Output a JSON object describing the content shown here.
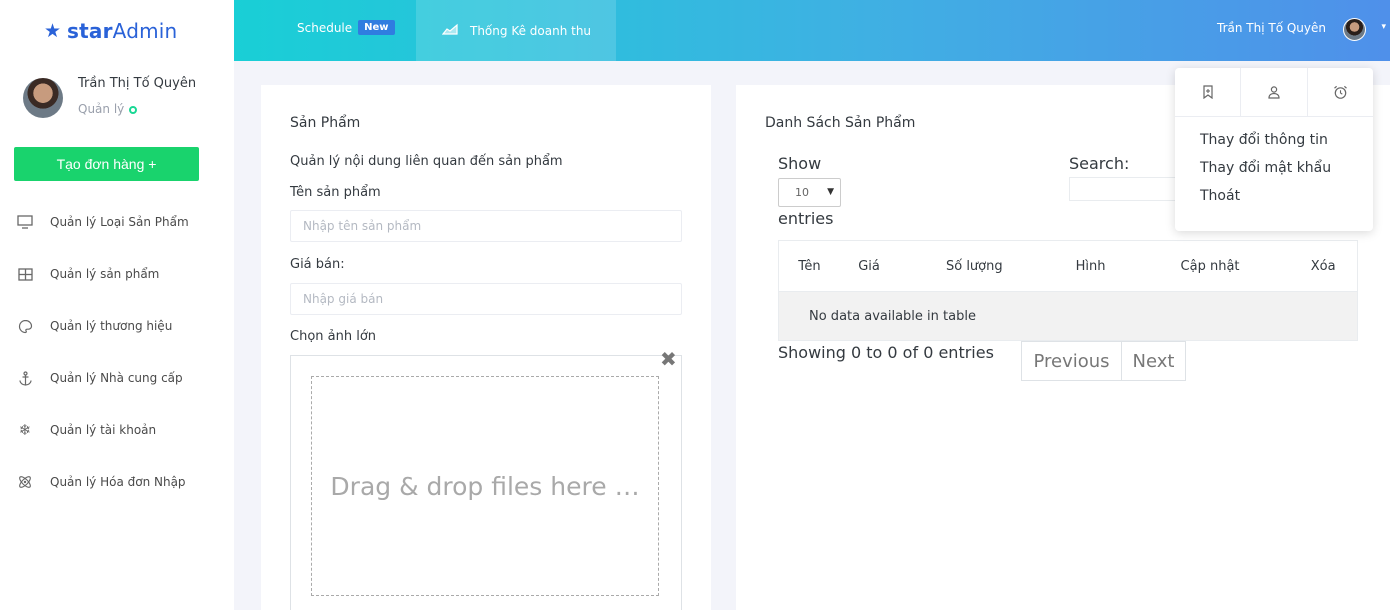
{
  "brand": {
    "logo_a": "star",
    "logo_b": "Admin"
  },
  "sidebar": {
    "user_name": "Trần Thị Tố Quyên",
    "user_role": "Quản lý",
    "create_button": "Tạo đơn hàng +",
    "items": [
      {
        "label": "Quản lý Loại Sản Phẩm",
        "icon": "monitor-icon"
      },
      {
        "label": "Quản lý sản phẩm",
        "icon": "grid-icon"
      },
      {
        "label": "Quản lý thương hiệu",
        "icon": "palette-icon"
      },
      {
        "label": "Quản lý Nhà cung cấp",
        "icon": "anchor-icon"
      },
      {
        "label": "Quản lý tài khoản",
        "icon": "snowflake-icon"
      },
      {
        "label": "Quản lý Hóa đơn Nhập",
        "icon": "atom-icon"
      }
    ]
  },
  "navbar": {
    "schedule_label": "Schedule",
    "schedule_badge": "New",
    "stats_label": "Thống Kê doanh thu",
    "user_name": "Trần Thị Tố Quyên"
  },
  "form": {
    "title": "Sản Phẩm",
    "description": "Quản lý nội dung liên quan đến sản phẩm",
    "name_label": "Tên sản phẩm",
    "name_placeholder": "Nhập tên sản phẩm",
    "price_label": "Giá bán:",
    "price_placeholder": "Nhập giá bán",
    "image_label": "Chọn ảnh lớn",
    "drop_text": "Drag & drop files here …"
  },
  "list": {
    "title": "Danh Sách Sản Phẩm",
    "show_label": "Show",
    "page_length": "10",
    "entries_label": "entries",
    "search_label": "Search:",
    "columns": [
      "Tên",
      "Giá",
      "Số lượng",
      "Hình",
      "Cập nhật",
      "Xóa"
    ],
    "empty_text": "No data available in table",
    "info": "Showing 0 to 0 of 0 entries",
    "prev": "Previous",
    "next": "Next"
  },
  "dropdown": {
    "items": [
      "Thay đổi thông tin",
      "Thay đổi mật khẩu",
      "Thoát"
    ]
  }
}
